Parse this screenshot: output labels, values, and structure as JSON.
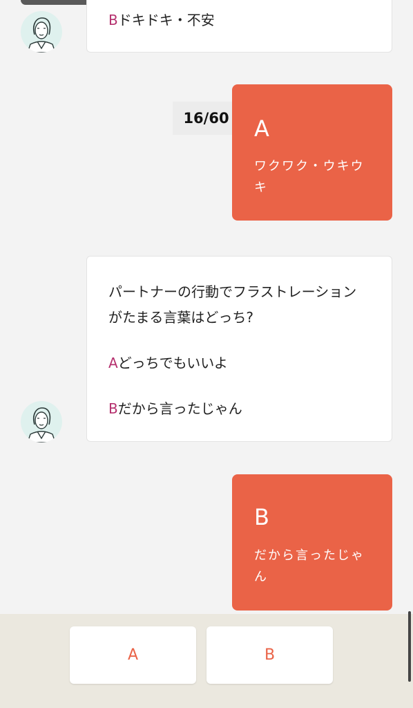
{
  "chat": {
    "prev_question": {
      "option_b_letter": "B",
      "option_b_text": "ドキドキ・不安"
    },
    "prev_answer": {
      "letter": "A",
      "text": "ワクワク・ウキウキ"
    },
    "progress": "16/60",
    "question": {
      "line1": "パートナーの行動でフラストレーション",
      "line2": "がたまる言葉はどっち?",
      "option_a_letter": "A",
      "option_a_text": "どっちでもいいよ",
      "option_b_letter": "B",
      "option_b_text": "だから言ったじゃん"
    },
    "answer": {
      "letter": "B",
      "text": "だから言ったじゃん"
    }
  },
  "choices": {
    "a_label": "A",
    "b_label": "B"
  },
  "colors": {
    "accent": "#ea6347",
    "option_letter": "#b5306e",
    "bottom_bar": "#ebe8df"
  }
}
